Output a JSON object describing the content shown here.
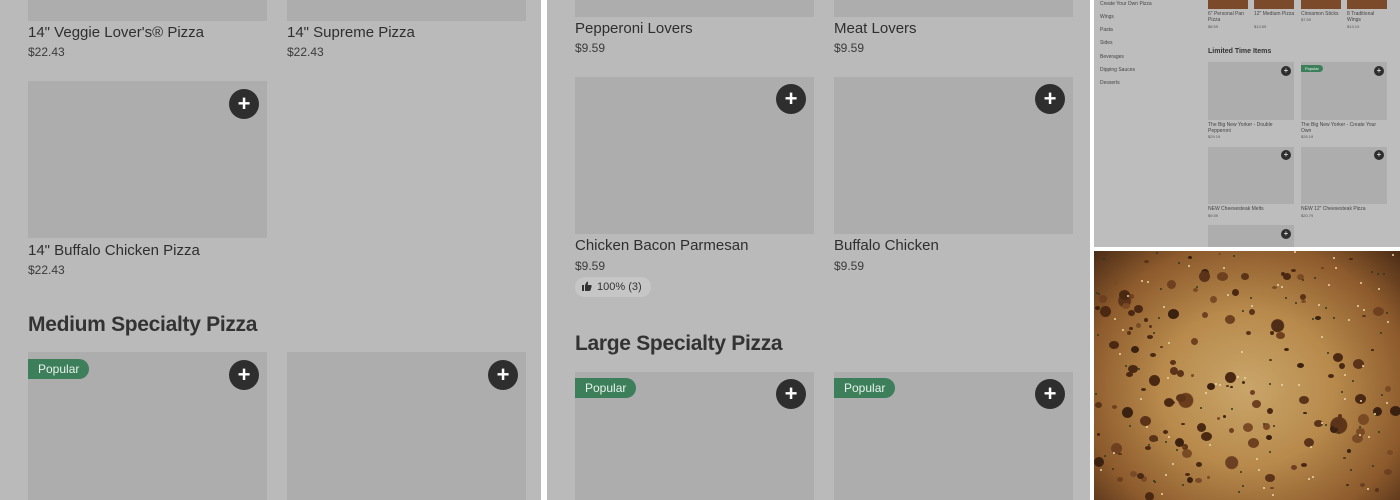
{
  "panel1": {
    "top_items": [
      {
        "name": "14\" Veggie Lover's® Pizza",
        "price": "$22.43"
      },
      {
        "name": "14\" Supreme Pizza",
        "price": "$22.43"
      }
    ],
    "item3": {
      "name": "14\" Buffalo Chicken Pizza",
      "price": "$22.43"
    },
    "section_heading": "Medium Specialty Pizza",
    "popular_badge": "Popular"
  },
  "panel2": {
    "top_items": [
      {
        "name": "Pepperoni Lovers",
        "price": "$9.59"
      },
      {
        "name": "Meat Lovers",
        "price": "$9.59"
      }
    ],
    "mid_items": [
      {
        "name": "Chicken Bacon Parmesan",
        "price": "$9.59",
        "rating": "100% (3)"
      },
      {
        "name": "Buffalo Chicken",
        "price": "$9.59"
      }
    ],
    "section_heading": "Large Specialty Pizza",
    "popular_badge": "Popular"
  },
  "panel3": {
    "sidebar": [
      "Create Your Own Pizza",
      "Wings",
      "Pasta",
      "Sides",
      "Beverages",
      "Dipping Sauces",
      "Desserts"
    ],
    "top_row": [
      {
        "name": "6\" Personal Pan Pizza",
        "price": "$8.59"
      },
      {
        "name": "12\" Medium Pizza",
        "price": "$13.59"
      },
      {
        "name": "Cinnamon Sticks",
        "price": "$7.59"
      },
      {
        "name": "8 Traditional Wings",
        "price": "$13.19"
      }
    ],
    "section_heading": "Limited Time Items",
    "items": [
      {
        "name": "The Big New Yorker - Double Pepperoni",
        "price": "$29.19"
      },
      {
        "name": "The Big New Yorker - Create Your Own",
        "price": "$26.19",
        "badge": "Popular"
      },
      {
        "name": "NEW Cheesesteak Melts",
        "price": "$9.59"
      },
      {
        "name": "NEW 12\" Cheesesteak Pizza",
        "price": "$20.79"
      }
    ]
  },
  "icons": {
    "add": "+",
    "thumbs_up": "thumbs-up-icon"
  }
}
